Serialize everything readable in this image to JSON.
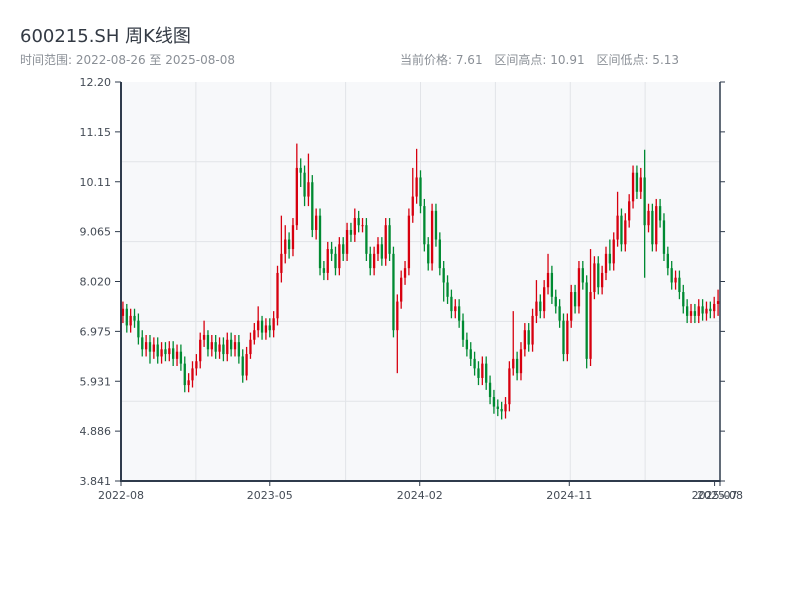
{
  "header": {
    "title": "600215.SH 周K线图",
    "range_label": "时间范围: 2022-08-26 至 2025-08-08",
    "current_price": "当前价格: 7.61",
    "range_high": "区间高点: 10.91",
    "range_low": "区间低点: 5.13"
  },
  "colors": {
    "up": "#d7000f",
    "down": "#008a32",
    "plot_bg": "#f7f8fa",
    "axis": "#2f3b4c",
    "grid": "#e2e4e8"
  },
  "chart_data": {
    "type": "candlestick",
    "title": "600215.SH 周K线图",
    "xlabel": "",
    "ylabel": "",
    "ylim": [
      3.841,
      12.2
    ],
    "y_ticks": [
      "12.20",
      "11.15",
      "10.11",
      "9.065",
      "8.020",
      "6.975",
      "5.931",
      "4.886",
      "3.841"
    ],
    "x_ticks": [
      {
        "label": "2022-08",
        "index": 0
      },
      {
        "label": "2023-05",
        "index": 38.5
      },
      {
        "label": "2024-02",
        "index": 77.3
      },
      {
        "label": "2024-11",
        "index": 116
      },
      {
        "label": "2025-07",
        "index": 153.6
      },
      {
        "label": "2025-08",
        "index": 155
      }
    ],
    "grid": true,
    "period": "weekly",
    "start_date": "2022-08-26",
    "end_date": "2025-08-08",
    "candle_format": [
      "open",
      "high",
      "low",
      "close"
    ],
    "candles": [
      [
        7.3,
        7.6,
        7.15,
        7.45
      ],
      [
        7.45,
        7.55,
        6.95,
        7.1
      ],
      [
        7.1,
        7.45,
        6.95,
        7.3
      ],
      [
        7.3,
        7.45,
        7.05,
        7.2
      ],
      [
        7.2,
        7.35,
        6.7,
        6.85
      ],
      [
        6.85,
        7.0,
        6.45,
        6.6
      ],
      [
        6.6,
        6.9,
        6.45,
        6.75
      ],
      [
        6.75,
        6.9,
        6.3,
        6.55
      ],
      [
        6.55,
        6.85,
        6.4,
        6.7
      ],
      [
        6.7,
        6.85,
        6.3,
        6.45
      ],
      [
        6.45,
        6.75,
        6.3,
        6.6
      ],
      [
        6.6,
        6.75,
        6.35,
        6.5
      ],
      [
        6.5,
        6.77,
        6.35,
        6.62
      ],
      [
        6.62,
        6.77,
        6.25,
        6.4
      ],
      [
        6.4,
        6.7,
        6.25,
        6.55
      ],
      [
        6.55,
        6.7,
        6.15,
        6.3
      ],
      [
        6.3,
        6.45,
        5.7,
        5.85
      ],
      [
        5.85,
        6.1,
        5.7,
        5.95
      ],
      [
        5.95,
        6.35,
        5.8,
        6.2
      ],
      [
        6.2,
        6.5,
        6.05,
        6.35
      ],
      [
        6.35,
        6.95,
        6.2,
        6.8
      ],
      [
        6.8,
        7.2,
        6.65,
        6.9
      ],
      [
        6.9,
        7.0,
        6.45,
        6.6
      ],
      [
        6.6,
        6.9,
        6.45,
        6.75
      ],
      [
        6.75,
        6.9,
        6.4,
        6.55
      ],
      [
        6.55,
        6.85,
        6.4,
        6.7
      ],
      [
        6.7,
        6.85,
        6.35,
        6.5
      ],
      [
        6.5,
        6.95,
        6.35,
        6.8
      ],
      [
        6.8,
        6.95,
        6.45,
        6.6
      ],
      [
        6.6,
        6.9,
        6.45,
        6.75
      ],
      [
        6.75,
        6.9,
        6.3,
        6.45
      ],
      [
        6.45,
        6.6,
        5.9,
        6.05
      ],
      [
        6.05,
        6.65,
        5.95,
        6.5
      ],
      [
        6.5,
        6.95,
        6.4,
        6.8
      ],
      [
        6.8,
        7.15,
        6.7,
        7.0
      ],
      [
        7.0,
        7.5,
        6.85,
        7.2
      ],
      [
        7.2,
        7.3,
        6.8,
        6.95
      ],
      [
        6.95,
        7.25,
        6.8,
        7.1
      ],
      [
        7.1,
        7.25,
        6.85,
        7.0
      ],
      [
        7.0,
        7.4,
        6.85,
        7.25
      ],
      [
        7.25,
        8.35,
        7.1,
        8.2
      ],
      [
        8.2,
        9.4,
        8.0,
        8.6
      ],
      [
        8.6,
        9.2,
        8.4,
        8.9
      ],
      [
        8.9,
        9.05,
        8.5,
        8.7
      ],
      [
        8.7,
        9.35,
        8.55,
        9.2
      ],
      [
        9.2,
        10.91,
        9.1,
        10.4
      ],
      [
        10.4,
        10.6,
        10.0,
        10.3
      ],
      [
        10.3,
        10.45,
        9.6,
        9.8
      ],
      [
        9.8,
        10.7,
        9.6,
        10.1
      ],
      [
        10.1,
        10.25,
        8.95,
        9.1
      ],
      [
        9.1,
        9.55,
        8.9,
        9.4
      ],
      [
        9.4,
        9.55,
        8.15,
        8.3
      ],
      [
        8.3,
        8.45,
        8.05,
        8.2
      ],
      [
        8.2,
        8.85,
        8.05,
        8.7
      ],
      [
        8.7,
        8.85,
        8.45,
        8.6
      ],
      [
        8.6,
        8.75,
        8.15,
        8.3
      ],
      [
        8.3,
        8.95,
        8.15,
        8.8
      ],
      [
        8.8,
        8.95,
        8.45,
        8.6
      ],
      [
        8.6,
        9.25,
        8.45,
        9.1
      ],
      [
        9.1,
        9.25,
        8.85,
        9.0
      ],
      [
        9.0,
        9.55,
        8.85,
        9.35
      ],
      [
        9.35,
        9.5,
        9.05,
        9.2
      ],
      [
        9.2,
        9.35,
        9.05,
        9.2
      ],
      [
        9.2,
        9.35,
        8.45,
        8.6
      ],
      [
        8.6,
        8.75,
        8.15,
        8.3
      ],
      [
        8.3,
        8.75,
        8.15,
        8.6
      ],
      [
        8.6,
        8.95,
        8.45,
        8.8
      ],
      [
        8.8,
        8.95,
        8.35,
        8.5
      ],
      [
        8.5,
        9.35,
        8.35,
        9.2
      ],
      [
        9.2,
        9.35,
        8.45,
        8.6
      ],
      [
        8.6,
        8.75,
        6.85,
        7.0
      ],
      [
        7.0,
        7.75,
        6.1,
        7.6
      ],
      [
        7.6,
        8.25,
        7.45,
        8.1
      ],
      [
        8.1,
        8.45,
        7.95,
        8.3
      ],
      [
        8.3,
        9.55,
        8.15,
        9.4
      ],
      [
        9.4,
        10.4,
        9.25,
        9.8
      ],
      [
        9.8,
        10.8,
        9.65,
        10.2
      ],
      [
        10.2,
        10.35,
        9.45,
        9.6
      ],
      [
        9.6,
        9.75,
        8.65,
        8.8
      ],
      [
        8.8,
        8.95,
        8.25,
        8.4
      ],
      [
        8.4,
        9.65,
        8.25,
        9.5
      ],
      [
        9.5,
        9.65,
        8.75,
        8.9
      ],
      [
        8.9,
        9.05,
        8.15,
        8.3
      ],
      [
        8.3,
        8.45,
        7.6,
        8.0
      ],
      [
        8.0,
        8.15,
        7.55,
        7.7
      ],
      [
        7.7,
        7.85,
        7.25,
        7.4
      ],
      [
        7.4,
        7.65,
        7.25,
        7.5
      ],
      [
        7.5,
        7.65,
        7.05,
        7.2
      ],
      [
        7.2,
        7.35,
        6.65,
        6.8
      ],
      [
        6.8,
        6.95,
        6.45,
        6.6
      ],
      [
        6.6,
        6.75,
        6.25,
        6.4
      ],
      [
        6.4,
        6.55,
        6.05,
        6.2
      ],
      [
        6.2,
        6.35,
        5.85,
        6.0
      ],
      [
        6.0,
        6.45,
        5.85,
        6.3
      ],
      [
        6.3,
        6.45,
        5.75,
        5.9
      ],
      [
        5.9,
        6.05,
        5.45,
        5.6
      ],
      [
        5.6,
        5.75,
        5.25,
        5.4
      ],
      [
        5.4,
        5.55,
        5.2,
        5.35
      ],
      [
        5.35,
        5.5,
        5.13,
        5.3
      ],
      [
        5.3,
        5.6,
        5.15,
        5.45
      ],
      [
        5.45,
        6.35,
        5.3,
        6.2
      ],
      [
        6.2,
        7.4,
        6.05,
        6.4
      ],
      [
        6.4,
        6.55,
        5.95,
        6.1
      ],
      [
        6.1,
        6.75,
        5.95,
        6.6
      ],
      [
        6.6,
        7.15,
        6.45,
        7.0
      ],
      [
        7.0,
        7.15,
        6.55,
        6.7
      ],
      [
        6.7,
        7.45,
        6.55,
        7.3
      ],
      [
        7.3,
        8.05,
        7.15,
        7.6
      ],
      [
        7.6,
        7.75,
        7.25,
        7.4
      ],
      [
        7.4,
        8.05,
        7.25,
        7.9
      ],
      [
        7.9,
        8.6,
        7.75,
        8.2
      ],
      [
        8.2,
        8.35,
        7.55,
        7.7
      ],
      [
        7.7,
        7.85,
        7.35,
        7.5
      ],
      [
        7.5,
        7.65,
        7.05,
        7.2
      ],
      [
        7.2,
        7.35,
        6.35,
        6.5
      ],
      [
        6.5,
        7.35,
        6.35,
        7.2
      ],
      [
        7.2,
        7.95,
        7.05,
        7.8
      ],
      [
        7.8,
        7.95,
        7.35,
        7.5
      ],
      [
        7.5,
        8.45,
        7.35,
        8.3
      ],
      [
        8.3,
        8.45,
        7.85,
        8.0
      ],
      [
        8.0,
        8.15,
        6.2,
        6.4
      ],
      [
        6.4,
        8.7,
        6.25,
        7.8
      ],
      [
        7.8,
        8.55,
        7.65,
        8.4
      ],
      [
        8.4,
        8.55,
        7.75,
        7.9
      ],
      [
        7.9,
        8.35,
        7.75,
        8.2
      ],
      [
        8.2,
        8.75,
        8.05,
        8.6
      ],
      [
        8.6,
        8.9,
        8.25,
        8.4
      ],
      [
        8.4,
        9.05,
        8.25,
        8.9
      ],
      [
        8.9,
        9.9,
        8.75,
        9.4
      ],
      [
        9.4,
        9.55,
        8.65,
        8.8
      ],
      [
        8.8,
        9.45,
        8.65,
        9.3
      ],
      [
        9.3,
        9.85,
        9.15,
        9.7
      ],
      [
        9.7,
        10.45,
        9.55,
        10.3
      ],
      [
        10.3,
        10.45,
        9.75,
        9.9
      ],
      [
        9.9,
        10.4,
        9.75,
        10.2
      ],
      [
        10.2,
        10.78,
        8.1,
        9.2
      ],
      [
        9.2,
        9.65,
        9.05,
        9.5
      ],
      [
        9.5,
        9.65,
        8.65,
        8.8
      ],
      [
        8.8,
        9.75,
        8.65,
        9.6
      ],
      [
        9.6,
        9.75,
        9.15,
        9.3
      ],
      [
        9.3,
        9.45,
        8.45,
        8.6
      ],
      [
        8.6,
        8.75,
        8.15,
        8.3
      ],
      [
        8.3,
        8.45,
        7.85,
        8.0
      ],
      [
        8.0,
        8.25,
        7.85,
        8.1
      ],
      [
        8.1,
        8.25,
        7.65,
        7.8
      ],
      [
        7.8,
        7.95,
        7.35,
        7.5
      ],
      [
        7.5,
        7.65,
        7.15,
        7.3
      ],
      [
        7.3,
        7.55,
        7.15,
        7.4
      ],
      [
        7.4,
        7.55,
        7.15,
        7.3
      ],
      [
        7.3,
        7.65,
        7.15,
        7.5
      ],
      [
        7.5,
        7.65,
        7.2,
        7.35
      ],
      [
        7.35,
        7.6,
        7.2,
        7.45
      ],
      [
        7.45,
        7.6,
        7.25,
        7.4
      ],
      [
        7.4,
        7.7,
        7.25,
        7.55
      ],
      [
        7.55,
        7.85,
        7.3,
        7.61
      ]
    ]
  }
}
